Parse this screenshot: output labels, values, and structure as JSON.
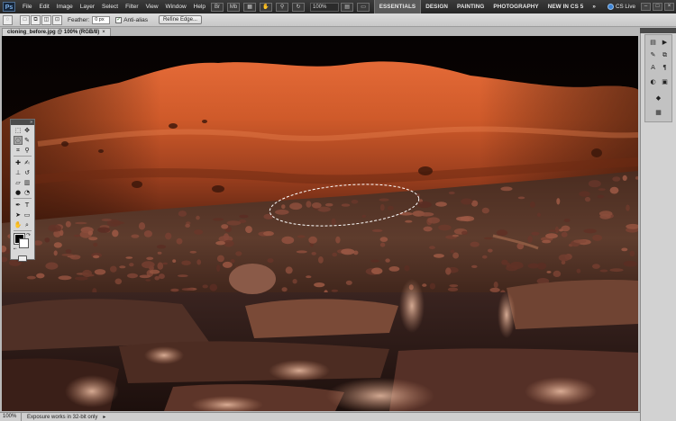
{
  "app": {
    "logo": "Ps",
    "menu": [
      "File",
      "Edit",
      "Image",
      "Layer",
      "Select",
      "Filter",
      "View",
      "Window",
      "Help"
    ],
    "zoom": "100%",
    "workspaces": [
      "ESSENTIALS",
      "DESIGN",
      "PAINTING",
      "PHOTOGRAPHY",
      "NEW IN CS 5"
    ],
    "overflow": "»",
    "cs_live": "CS Live",
    "window_controls": [
      "–",
      "□",
      "×"
    ]
  },
  "options": {
    "feather_label": "Feather:",
    "feather_value": "0 px",
    "antialias_label": "Anti-alias",
    "refine_edge": "Refine Edge..."
  },
  "document": {
    "tab_title": "cloning_before.jpg @ 100% (RGB/8)",
    "tab_close": "×"
  },
  "statusbar": {
    "zoom": "100%",
    "message": "Exposure works in 32-bit only",
    "arrow": "▸"
  },
  "toolbox": {
    "collapse": "»",
    "tools": [
      [
        "marquee-icon",
        "move-icon"
      ],
      [
        "lasso-icon",
        "quick-selection-icon"
      ],
      [
        "crop-icon",
        "eyedropper-icon"
      ],
      [
        "spot-healing-icon",
        "brush-icon"
      ],
      [
        "clone-stamp-icon",
        "history-brush-icon"
      ],
      [
        "eraser-icon",
        "gradient-icon"
      ],
      [
        "blur-icon",
        "dodge-icon"
      ],
      [
        "pen-icon",
        "type-icon"
      ],
      [
        "path-selection-icon",
        "shape-icon"
      ],
      [
        "hand-icon",
        "zoom-icon"
      ]
    ],
    "selected": "lasso-icon"
  },
  "colors": {
    "foreground": "#000000",
    "background": "#ffffff",
    "appbar": "#2f2f2f",
    "workspace_active": "#5a5a5a"
  }
}
